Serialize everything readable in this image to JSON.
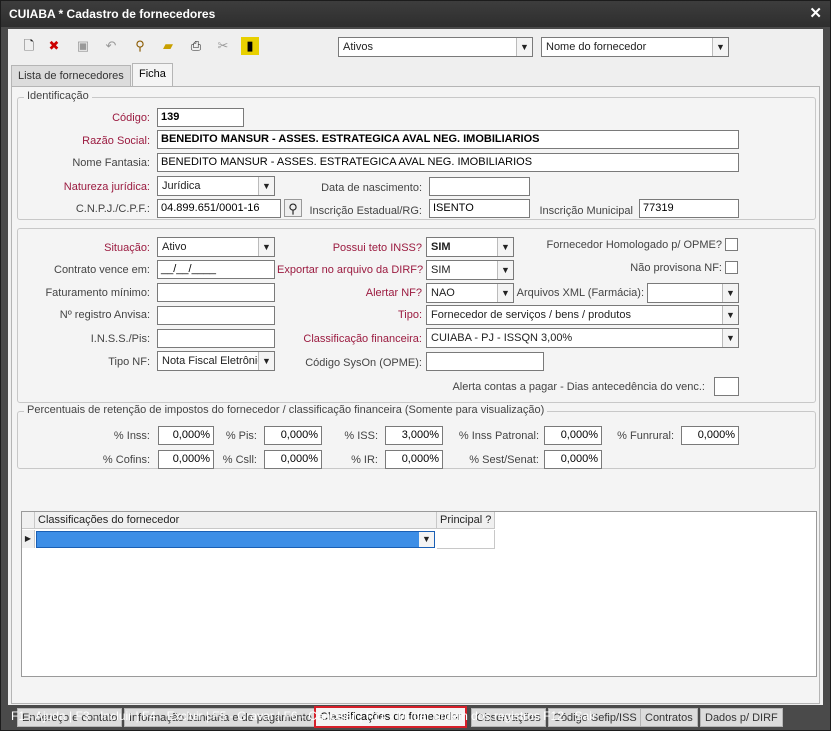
{
  "window": {
    "title": "CUIABA * Cadastro de fornecedores",
    "close": "✕"
  },
  "toolbar": {
    "icons": [
      "new-document-icon",
      "delete-document-icon",
      "save-icon",
      "undo-icon",
      "search-binoculars-icon",
      "open-folder-icon",
      "print-icon",
      "tools-icon",
      "exit-door-icon"
    ],
    "filter_status": "Ativos",
    "order_by": "Nome do fornecedor"
  },
  "top_tabs": [
    "Lista de fornecedores",
    "Ficha"
  ],
  "identificacao": {
    "legend": "Identificação",
    "codigo_label": "Código:",
    "codigo": "139",
    "razao_label": "Razão Social:",
    "razao": "BENEDITO MANSUR - ASSES. ESTRATEGICA AVAL NEG. IMOBILIARIOS",
    "fantasia_label": "Nome Fantasia:",
    "fantasia": "BENEDITO MANSUR - ASSES. ESTRATEGICA AVAL NEG. IMOBILIARIOS",
    "natureza_label": "Natureza jurídica:",
    "natureza": "Jurídica",
    "nascimento_label": "Data de nascimento:",
    "nascimento": "",
    "cnpj_label": "C.N.P.J./C.P.F.:",
    "cnpj": "04.899.651/0001-16",
    "ie_label": "Inscrição Estadual/RG:",
    "ie": "ISENTO",
    "im_label": "Inscrição Municipal",
    "im": "77319"
  },
  "detalhes": {
    "situacao_label": "Situação:",
    "situacao": "Ativo",
    "teto_label": "Possui teto INSS?",
    "teto": "SIM",
    "opme_label": "Fornecedor Homologado p/ OPME?",
    "contrato_label": "Contrato vence em:",
    "contrato": "__/__/____",
    "dirf_label": "Exportar no arquivo da DIRF?",
    "dirf": "SIM",
    "provisiona_label": "Não provisona NF:",
    "faturamento_label": "Faturamento mínimo:",
    "alertar_label": "Alertar NF?",
    "alertar": "NAO",
    "xml_label": "Arquivos XML (Farmácia):",
    "anvisa_label": "Nº registro Anvisa:",
    "tipo_label": "Tipo:",
    "tipo": "Fornecedor de serviços / bens / produtos",
    "inss_pis_label": "I.N.S.S./Pis:",
    "classif_label": "Classificação financeira:",
    "classif": "CUIABA - PJ - ISSQN 3,00%",
    "tiponf_label": "Tipo NF:",
    "tiponf": "Nota Fiscal Eletrônic",
    "syson_label": "Código SysOn (OPME):",
    "alerta_label": "Alerta contas a pagar - Dias antecedência do venc.:"
  },
  "percentuais": {
    "legend": "Percentuais de retenção de impostos do fornecedor / classificação financeira (Somente para visualização)",
    "inss_label": "% Inss:",
    "inss": "0,000%",
    "pis_label": "% Pis:",
    "pis": "0,000%",
    "iss_label": "% ISS:",
    "iss": "3,000%",
    "patronal_label": "% Inss Patronal:",
    "patronal": "0,000%",
    "funrural_label": "% Funrural:",
    "funrural": "0,000%",
    "cofins_label": "% Cofins:",
    "cofins": "0,000%",
    "csll_label": "% Csll:",
    "csll": "0,000%",
    "ir_label": "% IR:",
    "ir": "0,000%",
    "sest_label": "% Sest/Senat:",
    "sest": "0,000%"
  },
  "grid": {
    "col1": "Classificações do fornecedor",
    "col2": "Principal ?"
  },
  "bottom_tabs": [
    "Endereço e contato",
    "Informação bancária e de pagamento",
    "Classificações do fornecedor",
    "Observações",
    "Código Sefip/ISS",
    "Contratos",
    "Dados p/ DIRF"
  ],
  "status": "F1 - Ajuda   | F3 - Incluir   | F4 - Excluir   | F5 - Gravar   | F6 - Cancelar   | F11 - Mudar ordem dos registros F12 - Sair"
}
